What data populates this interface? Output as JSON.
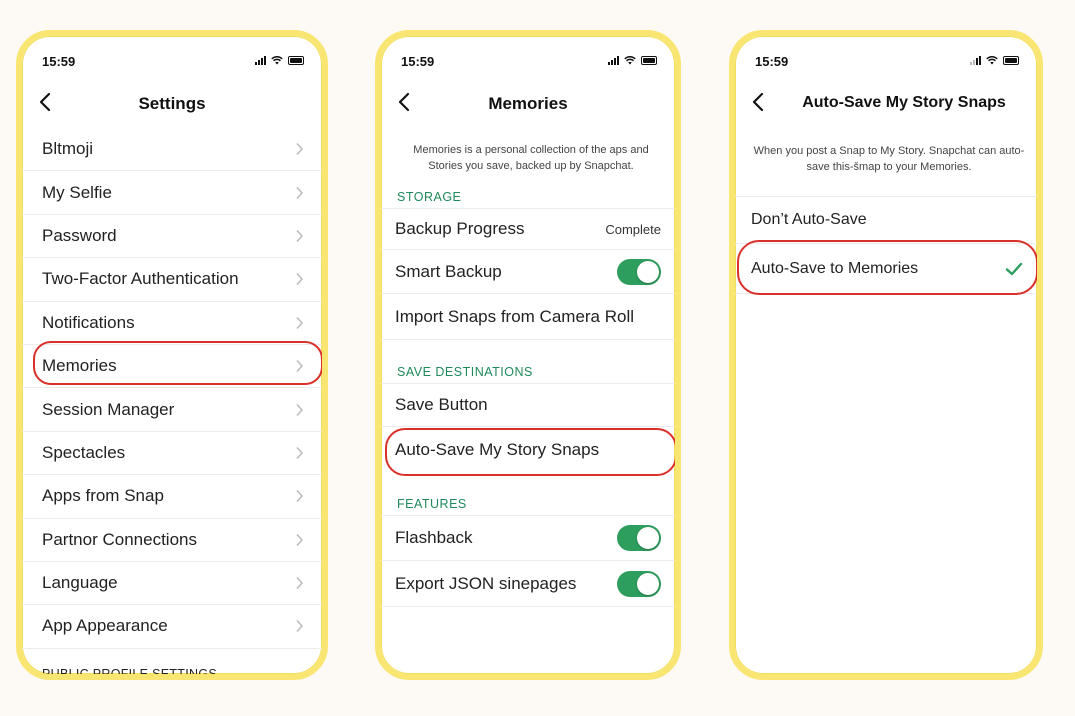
{
  "status": {
    "time": "15:59"
  },
  "screens": {
    "settings": {
      "title": "Settings",
      "items": [
        "Bltmoji",
        "My Selfie",
        "Password",
        "Two-Factor Authentication",
        "Notifications",
        "Memories",
        "Session Manager",
        "Spectacles",
        "Apps from Snap",
        "Partnor Connections",
        "Language",
        "App Appearance"
      ],
      "section_footer": "PUBLIC PROFILE SETTINGS",
      "highlighted_item": "Memories"
    },
    "memories": {
      "title": "Memories",
      "description": "Memories is a personal collection of the aps and Stories you save, backed up by Snapchat.",
      "storage_label": "STORAGE",
      "backup_progress_label": "Backup Progress",
      "backup_progress_value": "Complete",
      "smart_backup_label": "Smart Backup",
      "smart_backup_on": true,
      "import_label": "Import Snaps from Camera Roll",
      "save_destinations_label": "SAVE DESTINATIONS",
      "save_button_label": "Save Button",
      "auto_save_label": "Auto-Save My Story Snaps",
      "features_label": "FEATURES",
      "flashback_label": "Flashback",
      "flashback_on": true,
      "export_label": "Export JSON sinepages",
      "export_on": true,
      "accent_color": "#2e9e5e"
    },
    "autosave": {
      "title": "Auto-Save My Story Snaps",
      "description": "When you post a Snap to My Story. Snapchat can auto-save this-šmap to your Memories.",
      "option_off": "Don’t Auto-Save",
      "option_on": "Auto-Save to Memories",
      "selected": "Auto-Save to Memories"
    }
  },
  "colors": {
    "frame": "#f9e672",
    "highlight": "#d9302a",
    "section_label": "#1f8a5a",
    "toggle_on": "#2e9e5e"
  }
}
